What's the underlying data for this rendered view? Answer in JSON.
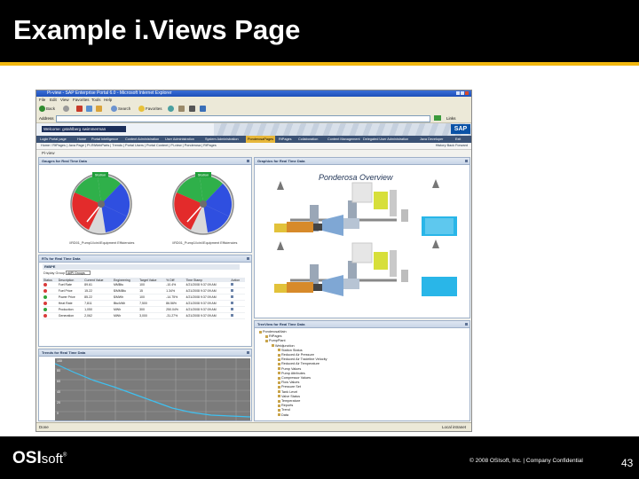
{
  "slide": {
    "title": "Example i.Views Page",
    "footer": {
      "logo_main": "OSI",
      "logo_sub": "soft",
      "logo_mark": "®",
      "confidentiality": "© 2008 OSIsoft, Inc. | Company Confidential",
      "page_number": "43"
    },
    "colors": {
      "title_bar": "#000000",
      "accent_rule": "#f2b70f"
    }
  },
  "browser": {
    "window_title": "Pi-view - SAP Enterprise Portal 6.0 - Microsoft Internet Explorer",
    "menus": [
      "File",
      "Edit",
      "View",
      "Favorites",
      "Tools",
      "Help"
    ],
    "toolbar": {
      "back": "Back",
      "search": "Search",
      "favorites": "Favorites"
    },
    "address_label": "Address",
    "address_value": "",
    "links_label": "Links",
    "status_left": "Done",
    "status_right": "Local intranet"
  },
  "portal": {
    "welcome": "Welcome: gstahlberg swimmerman",
    "logo": "SAP",
    "nav_tabs": [
      {
        "label": "Login Portal page"
      },
      {
        "label": "Home"
      },
      {
        "label": "Portal Intelligence"
      },
      {
        "label": "Content Administration"
      },
      {
        "label": "User Administration"
      },
      {
        "label": "System Administration"
      },
      {
        "label": "PonderosaPages",
        "active": true
      },
      {
        "label": "RtPages"
      },
      {
        "label": "Collaboration"
      },
      {
        "label": "Content Management"
      },
      {
        "label": "Delegated User Administration"
      },
      {
        "label": "Java Developer"
      },
      {
        "label": "Exit"
      }
    ],
    "breadcrumb": "Home / RtPages | Java Page | PI-RtWebParts | Trends | Portal Users | Portal Content | Pi-view | Ponderosa | RtPages",
    "history": "History  Back  Forward",
    "page_label": "Pi-view"
  },
  "panels": {
    "gauges": {
      "title": "Gauges for Real Time Data",
      "labels": [
        {
          "caption": "Station"
        },
        {
          "caption": "Station"
        }
      ],
      "captions": [
        "\\\\RD01_Pump1\\\\cin\\\\Equipment Efficiencies",
        "\\\\RD01_Pump1\\\\cin\\\\Equipment Efficiencies"
      ]
    },
    "graphics": {
      "title": "Graphics for Real Time Data",
      "diagram_title": "Ponderosa Overview"
    },
    "table": {
      "title": "RTs for Real Time Data",
      "group": "RtBPE",
      "control_label": "Display Group",
      "select_value": "AllPI Groups",
      "columns": [
        "Status",
        "Description",
        "Current Value",
        "Engineering",
        "Target Value",
        "% Diff",
        "Time Stamp",
        "Action"
      ],
      "rows": [
        {
          "color": "#d93a3a",
          "desc": "Fuel Rate",
          "value": "89.61",
          "unit": "MMBtu",
          "target": "100",
          "diff": "-10.4%",
          "time": "4/21/2008 9:37:09 AM"
        },
        {
          "color": "#d93a3a",
          "desc": "Fuel Price",
          "value": "15.22",
          "unit": "$/MMBtu",
          "target": "15",
          "diff": "1.34%",
          "time": "4/21/2008 9:37:09 AM"
        },
        {
          "color": "#2fa33a",
          "desc": "Power Price",
          "value": "85.22",
          "unit": "$/MWh",
          "target": "100",
          "diff": "-14.75%",
          "time": "4/21/2008 9:37:09 AM"
        },
        {
          "color": "#d93a3a",
          "desc": "Heat Rate",
          "value": "7,811",
          "unit": "Btu/kWh",
          "target": "7,500",
          "diff": "86.56%",
          "time": "4/21/2008 9:37:09 AM"
        },
        {
          "color": "#2fa33a",
          "desc": "Production",
          "value": "1,050",
          "unit": "MWh",
          "target": "300",
          "diff": "250.04%",
          "time": "4/21/2008 9:37:09 AM"
        },
        {
          "color": "#d93a3a",
          "desc": "Generation",
          "value": "2,062",
          "unit": "MWh",
          "target": "3,000",
          "diff": "-31.27%",
          "time": "4/21/2008 9:37:09 AM"
        }
      ]
    },
    "trend": {
      "title": "Trends for Real Time Data",
      "y_ticks": [
        "100",
        "80",
        "60",
        "40",
        "20",
        "0"
      ]
    },
    "tree": {
      "title": "TreeView for Real Time Data",
      "items": [
        {
          "label": "PonderosaMain",
          "level": 0
        },
        {
          "label": "RtPages",
          "level": 1
        },
        {
          "label": "PumpPlant",
          "level": 1
        },
        {
          "label": "Weldjunction",
          "level": 2
        },
        {
          "label": "Station Status",
          "level": 3
        },
        {
          "label": "Reduced Air Pressure",
          "level": 3
        },
        {
          "label": "Reduced Air Tradeline Velocity",
          "level": 3
        },
        {
          "label": "Reduced Air Temperature",
          "level": 3
        },
        {
          "label": "Pump Values",
          "level": 3
        },
        {
          "label": "Pump Attributes",
          "level": 3
        },
        {
          "label": "Compressor Values",
          "level": 3
        },
        {
          "label": "Flow Values",
          "level": 3
        },
        {
          "label": "Pressure Set",
          "level": 3
        },
        {
          "label": "Tank Level",
          "level": 3
        },
        {
          "label": "Valve Status",
          "level": 3
        },
        {
          "label": "Temperature",
          "level": 3
        },
        {
          "label": "Reports",
          "level": 3
        },
        {
          "label": "Trend",
          "level": 3
        },
        {
          "label": "Data",
          "level": 3
        }
      ]
    }
  }
}
